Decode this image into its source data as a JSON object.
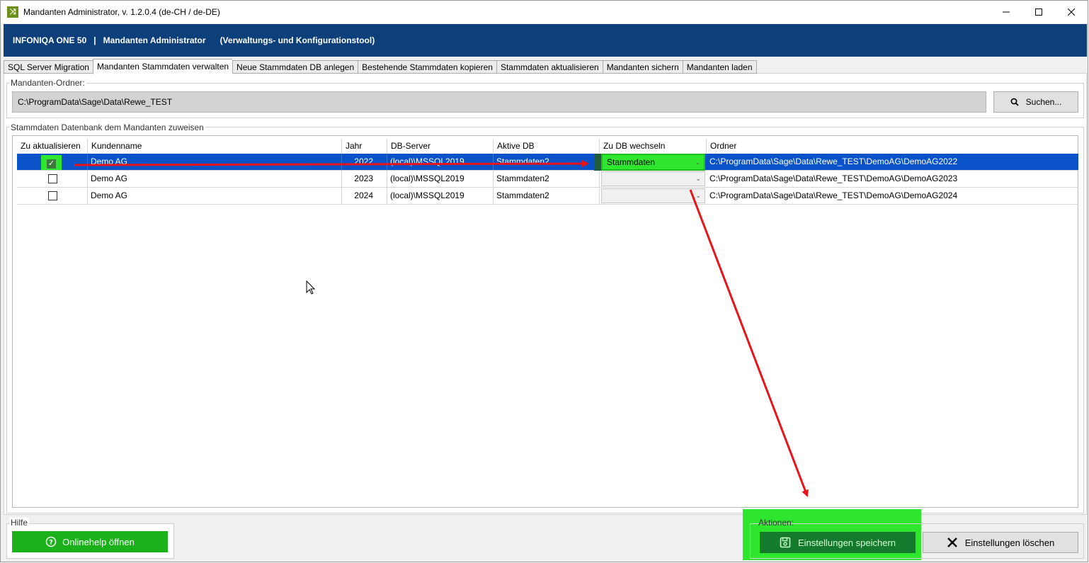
{
  "window": {
    "title": "Mandanten Administrator, v. 1.2.0.4 (de-CH / de-DE)",
    "app_icon": "shuffle-icon"
  },
  "header": {
    "product": "INFONIQA ONE 50",
    "separator": "|",
    "app": "Mandanten Administrator",
    "subtitle": "(Verwaltungs- und Konfigurationstool)"
  },
  "tabs": [
    {
      "label": "SQL Server Migration",
      "active": false
    },
    {
      "label": "Mandanten Stammdaten verwalten",
      "active": true
    },
    {
      "label": "Neue Stammdaten DB anlegen",
      "active": false
    },
    {
      "label": "Bestehende Stammdaten kopieren",
      "active": false
    },
    {
      "label": "Stammdaten aktualisieren",
      "active": false
    },
    {
      "label": "Mandanten sichern",
      "active": false
    },
    {
      "label": "Mandanten laden",
      "active": false
    }
  ],
  "folder": {
    "label": "Mandanten-Ordner:",
    "value": "C:\\ProgramData\\Sage\\Data\\Rewe_TEST",
    "search_label": "Suchen..."
  },
  "grid": {
    "group_label": "Stammdaten Datenbank dem Mandanten zuweisen",
    "columns": [
      "Zu aktualisieren",
      "Kundenname",
      "Jahr",
      "DB-Server",
      "Aktive DB",
      "Zu DB wechseln",
      "Ordner"
    ],
    "rows": [
      {
        "checked": true,
        "name": "Demo AG",
        "year": "2022",
        "server": "(local)\\MSSQL2019",
        "active_db": "Stammdaten2",
        "switch_db": "Stammdaten",
        "folder": "C:\\ProgramData\\Sage\\Data\\Rewe_TEST\\DemoAG\\DemoAG2022",
        "selected": true
      },
      {
        "checked": false,
        "name": "Demo AG",
        "year": "2023",
        "server": "(local)\\MSSQL2019",
        "active_db": "Stammdaten2",
        "switch_db": "",
        "folder": "C:\\ProgramData\\Sage\\Data\\Rewe_TEST\\DemoAG\\DemoAG2023",
        "selected": false
      },
      {
        "checked": false,
        "name": "Demo AG",
        "year": "2024",
        "server": "(local)\\MSSQL2019",
        "active_db": "Stammdaten2",
        "switch_db": "",
        "folder": "C:\\ProgramData\\Sage\\Data\\Rewe_TEST\\DemoAG\\DemoAG2024",
        "selected": false
      }
    ]
  },
  "help": {
    "group_label": "Hilfe",
    "button_label": "Onlinehelp öffnen"
  },
  "actions": {
    "group_label": "Aktionen:",
    "save_label": "Einstellungen speichern",
    "delete_label": "Einstellungen löschen"
  },
  "colors": {
    "brand": "#0d3f7a",
    "selection": "#0a52c8",
    "highlight": "#2ee62e",
    "help_button": "#1ab11a",
    "save_button": "#147a2c",
    "arrow": "#e8141a"
  }
}
